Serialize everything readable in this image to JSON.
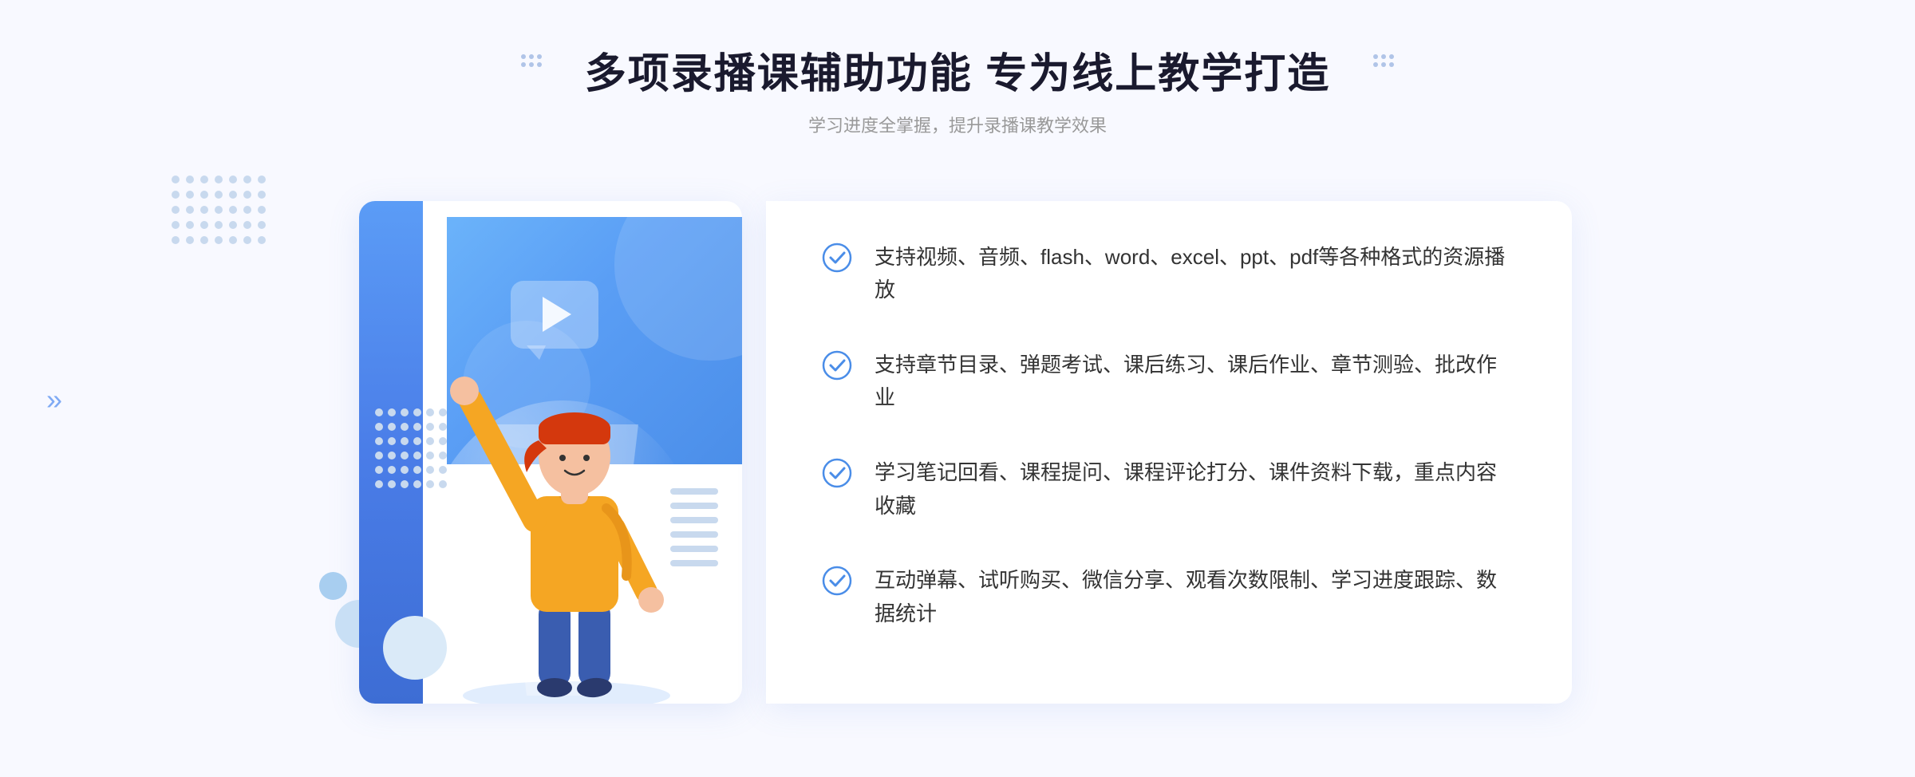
{
  "header": {
    "title": "多项录播课辅助功能 专为线上教学打造",
    "subtitle": "学习进度全掌握，提升录播课教学效果"
  },
  "features": [
    {
      "id": "feature-1",
      "text": "支持视频、音频、flash、word、excel、ppt、pdf等各种格式的资源播放"
    },
    {
      "id": "feature-2",
      "text": "支持章节目录、弹题考试、课后练习、课后作业、章节测验、批改作业"
    },
    {
      "id": "feature-3",
      "text": "学习笔记回看、课程提问、课程评论打分、课件资料下载，重点内容收藏"
    },
    {
      "id": "feature-4",
      "text": "互动弹幕、试听购买、微信分享、观看次数限制、学习进度跟踪、数据统计"
    }
  ],
  "colors": {
    "primary_blue": "#5a9ef5",
    "light_blue": "#d0e6fa",
    "check_blue": "#4a8de8",
    "text_dark": "#333333",
    "text_gray": "#999999"
  },
  "icons": {
    "check": "check-circle-icon",
    "play": "play-icon",
    "chevron": "chevron-left-icon"
  }
}
